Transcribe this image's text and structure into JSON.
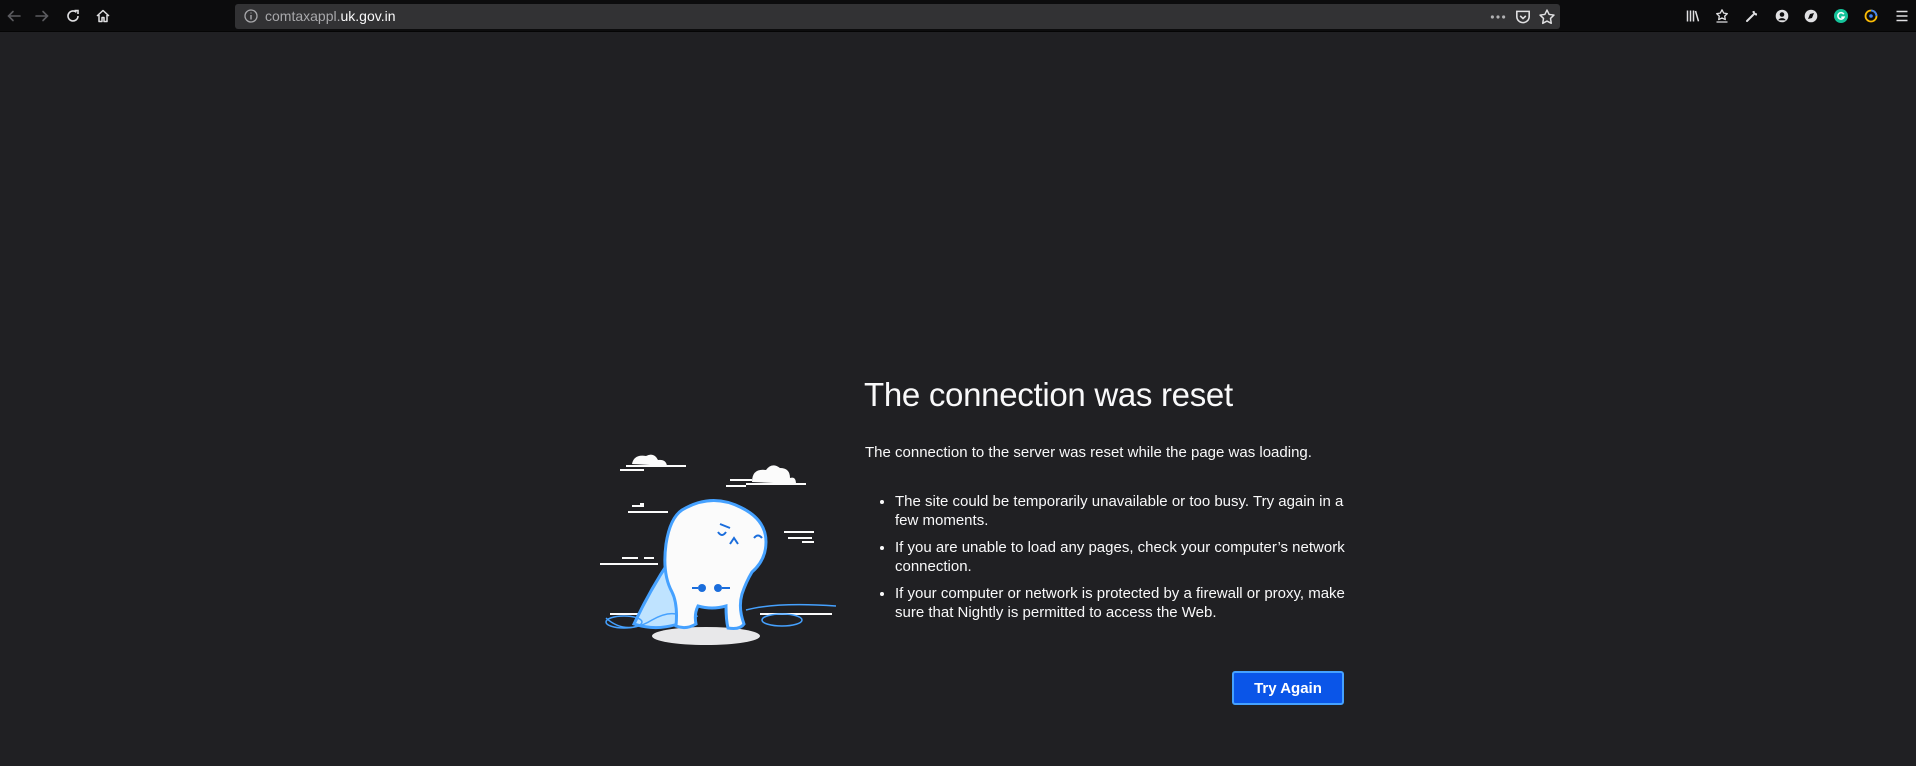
{
  "browser": {
    "url_prefix": "comtaxappl.",
    "url_domain": "uk.gov.in",
    "nav_icons": [
      "back-icon",
      "forward-icon",
      "reload-icon",
      "home-icon"
    ],
    "page_action_icons": [
      "more-actions-icon",
      "pocket-icon",
      "bookmark-star-icon"
    ],
    "toolbar_icons": [
      "library-icon",
      "sidebar-icon",
      "developer-wrench-icon",
      "account-icon",
      "extension-icon",
      "grammarly-icon",
      "extension-color-icon",
      "menu-icon"
    ]
  },
  "error_page": {
    "title": "The connection was reset",
    "description": "The connection to the server was reset while the page was loading.",
    "suggestions": [
      "The site could be temporarily unavailable or too busy. Try again in a few moments.",
      "If you are unable to load any pages, check your computer’s network connection.",
      "If your computer or network is protected by a firewall or proxy, make sure that Nightly is permitted to access the Web."
    ],
    "try_again_label": "Try Again"
  },
  "colors": {
    "page_background": "#202023",
    "toolbar_background": "#0c0c0d",
    "urlbar_background": "#323234",
    "button_background": "#0a55e8",
    "button_border": "#45a1ff",
    "illustration_accent": "#45a1ff"
  }
}
